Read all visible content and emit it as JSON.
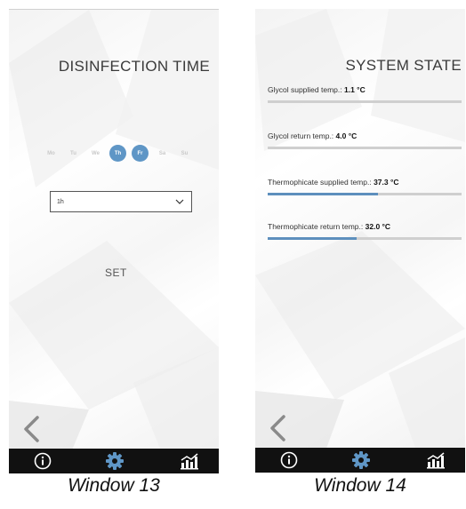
{
  "window13": {
    "title": "DISINFECTION TIME",
    "days": [
      {
        "label": "Mo",
        "selected": false
      },
      {
        "label": "Tu",
        "selected": false
      },
      {
        "label": "We",
        "selected": false
      },
      {
        "label": "Th",
        "selected": true
      },
      {
        "label": "Fr",
        "selected": true
      },
      {
        "label": "Sa",
        "selected": false
      },
      {
        "label": "Su",
        "selected": false
      }
    ],
    "duration_value": "1h",
    "set_label": "SET",
    "caption": "Window 13"
  },
  "window14": {
    "title": "SYSTEM STATE",
    "rows": [
      {
        "label": "Glycol supplied temp.:",
        "value": "1.1 °C",
        "level": 0.0
      },
      {
        "label": "Glycol return temp.:",
        "value": "4.0 °C",
        "level": 0.0
      },
      {
        "label": "Thermophicate supplied temp.:",
        "value": "37.3 °C",
        "level": 0.57
      },
      {
        "label": "Thermophicate return temp.:",
        "value": "32.0 °C",
        "level": 0.46
      }
    ],
    "caption": "Window 14"
  },
  "colors": {
    "accent": "#5f96c6",
    "navbar": "#111111",
    "bar_fill": "#5d8fbd"
  },
  "navbar_icons": [
    "info-icon",
    "settings-gear-icon",
    "statistics-chart-icon"
  ]
}
